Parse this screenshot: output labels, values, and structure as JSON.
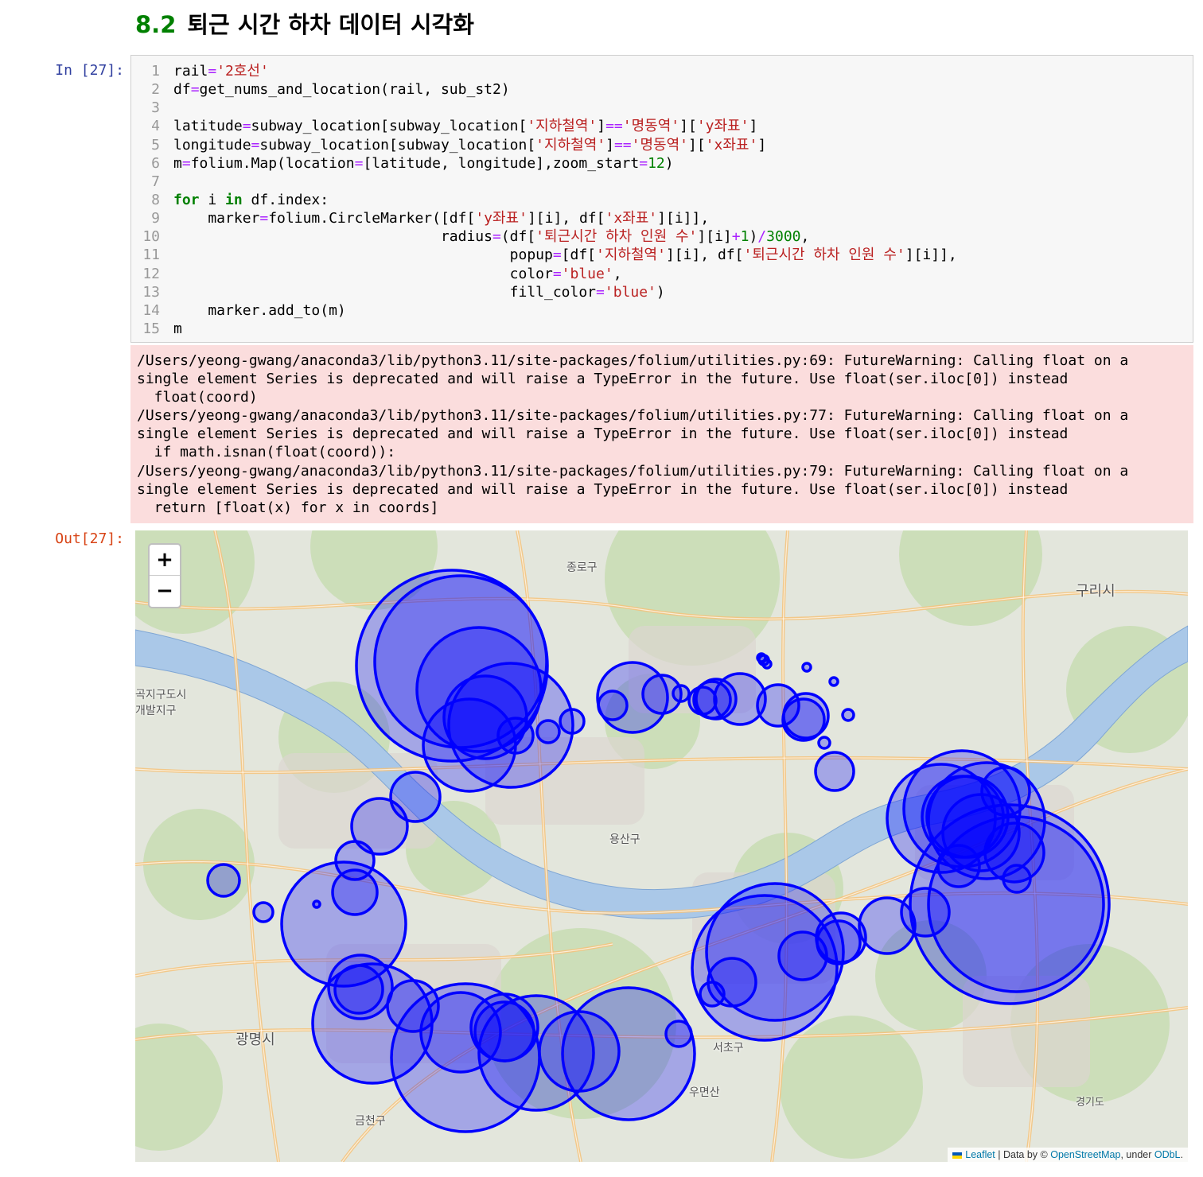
{
  "heading": {
    "number": "8.2",
    "title": "퇴근 시간 하차 데이터 시각화"
  },
  "cell": {
    "in_prompt": "In [27]:",
    "out_prompt": "Out[27]:",
    "code_lines": [
      "rail='2호선'",
      "df=get_nums_and_location(rail, sub_st2)",
      "",
      "latitude=subway_location[subway_location['지하철역']=='명동역']['y좌표']",
      "longitude=subway_location[subway_location['지하철역']=='명동역']['x좌표']",
      "m=folium.Map(location=[latitude, longitude],zoom_start=12)",
      "",
      "for i in df.index:",
      "    marker=folium.CircleMarker([df['y좌표'][i], df['x좌표'][i]],",
      "                               radius=(df['퇴근시간 하차 인원 수'][i]+1)/3000,",
      "                                       popup=[df['지하철역'][i], df['퇴근시간 하차 인원 수'][i]],",
      "                                       color='blue',",
      "                                       fill_color='blue')",
      "    marker.add_to(m)",
      "m"
    ],
    "stderr": "/Users/yeong-gwang/anaconda3/lib/python3.11/site-packages/folium/utilities.py:69: FutureWarning: Calling float on a\nsingle element Series is deprecated and will raise a TypeError in the future. Use float(ser.iloc[0]) instead\n  float(coord)\n/Users/yeong-gwang/anaconda3/lib/python3.11/site-packages/folium/utilities.py:77: FutureWarning: Calling float on a\nsingle element Series is deprecated and will raise a TypeError in the future. Use float(ser.iloc[0]) instead\n  if math.isnan(float(coord)):\n/Users/yeong-gwang/anaconda3/lib/python3.11/site-packages/folium/utilities.py:79: FutureWarning: Calling float on a\nsingle element Series is deprecated and will raise a TypeError in the future. Use float(ser.iloc[0]) instead\n  return [float(x) for x in coords]"
  },
  "map": {
    "zoom_in": "+",
    "zoom_out": "−",
    "marker_color": "#0000ff",
    "marker_fill": "#0000ff",
    "river_color": "#aac8e8",
    "labels": [
      "구리시",
      "광명시",
      "용산구",
      "서초구",
      "우면산",
      "금천구",
      "종로구",
      "곡지구도시",
      "개발지구",
      "경기도"
    ],
    "attribution": {
      "leaflet": "Leaflet",
      "data_by": " | Data by © ",
      "osm": "OpenStreetMap",
      "under": ", under ",
      "odbl": "ODbL",
      "end": "."
    }
  }
}
